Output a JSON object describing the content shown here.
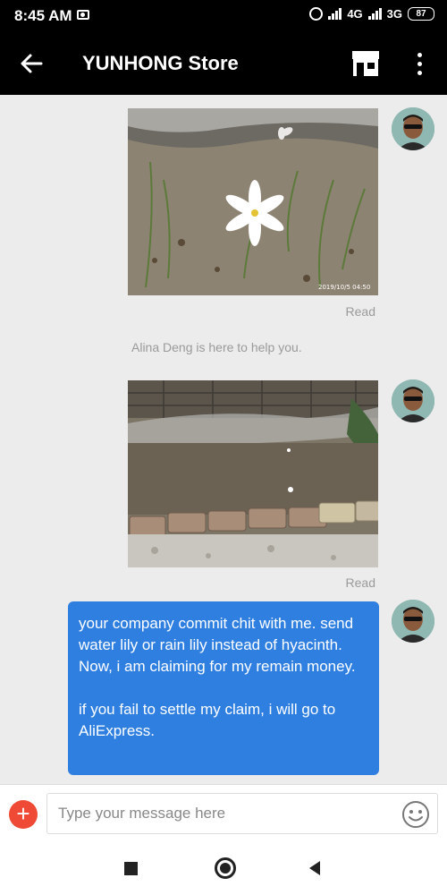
{
  "status_bar": {
    "time": "8:45 AM",
    "network_1": "4G",
    "network_2": "3G",
    "battery": "87"
  },
  "header": {
    "title": "YUNHONG Store",
    "icons": [
      "back-arrow-icon",
      "store-icon",
      "more-vertical-icon"
    ]
  },
  "messages": [
    {
      "type": "image",
      "content": "photo of a white rain lily flower in soil",
      "status": "Read"
    },
    {
      "type": "system",
      "text": "Alina Deng is here to help you."
    },
    {
      "type": "image",
      "content": "photo of a garden bed bordered with bricks",
      "status": "Read"
    },
    {
      "type": "text",
      "paragraphs": [
        "your company  commit chit with me. send water lily or rain lily instead of hyacinth.  Now, i am claiming for my remain money.",
        "if you fail to settle my claim, i will go to AliExpress."
      ]
    }
  ],
  "photo_1_stamp": "2019/10/5 04:50",
  "input": {
    "placeholder": "Type your message here"
  },
  "colors": {
    "bubble": "#2f7fe0",
    "add_button": "#ef4a35",
    "header": "#000000",
    "background": "#ececec"
  }
}
